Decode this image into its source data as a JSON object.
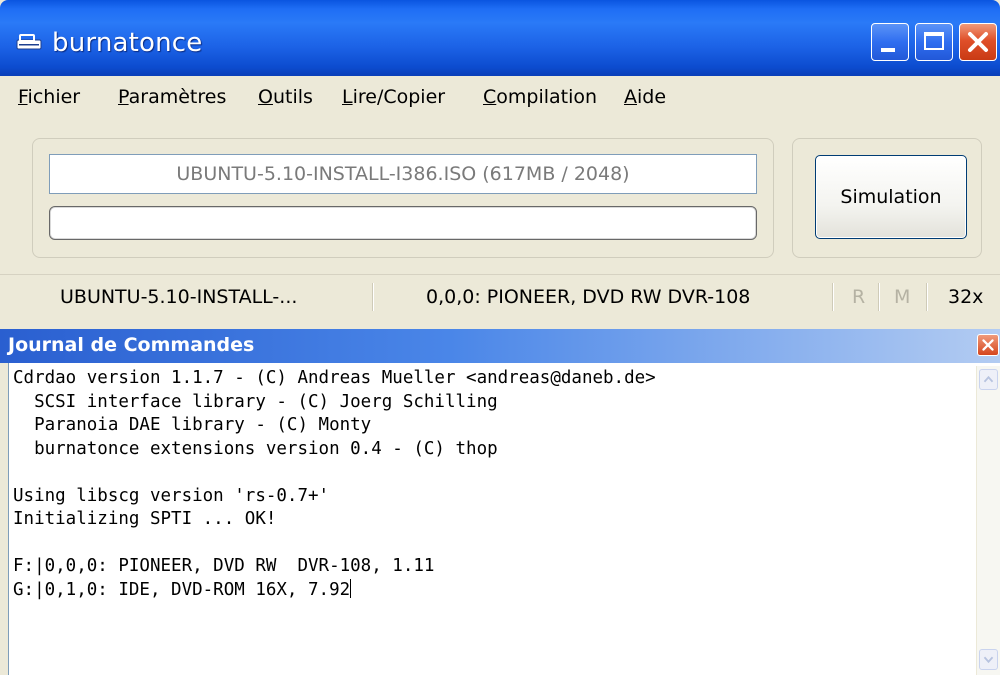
{
  "window": {
    "title": "burnatonce",
    "icon": "cd-drive-icon",
    "controls": {
      "minimize": "minimize-icon",
      "maximize": "maximize-icon",
      "close": "close-icon"
    }
  },
  "menu": [
    "Fichier",
    "Paramètres",
    "Outils",
    "Lire/Copier",
    "Compilation",
    "Aide"
  ],
  "main": {
    "file_label": "UBUNTU-5.10-INSTALL-I386.ISO (617MB / 2048)",
    "progress": 0,
    "simulate_label": "Simulation"
  },
  "status": {
    "file": "UBUNTU-5.10-INSTALL-...",
    "device": "0,0,0: PIONEER, DVD RW  DVR-108",
    "r": "R",
    "m": "M",
    "speed": "32x"
  },
  "journal": {
    "title": "Journal de Commandes",
    "lines": [
      "Cdrdao version 1.1.7 - (C) Andreas Mueller <andreas@daneb.de>",
      "  SCSI interface library - (C) Joerg Schilling",
      "  Paranoia DAE library - (C) Monty",
      "  burnatonce extensions version 0.4 - (C) thop",
      "",
      "Using libscg version 'rs-0.7+'",
      "Initializing SPTI ... OK!",
      "",
      "F:|0,0,0: PIONEER, DVD RW  DVR-108, 1.11",
      "G:|0,1,0: IDE, DVD-ROM 16X, 7.92"
    ]
  },
  "colors": {
    "titlebar": "#2a7af7",
    "window_bg": "#ece9d8",
    "journal_header": "#2a5fd0",
    "close_red": "#e0502a"
  }
}
